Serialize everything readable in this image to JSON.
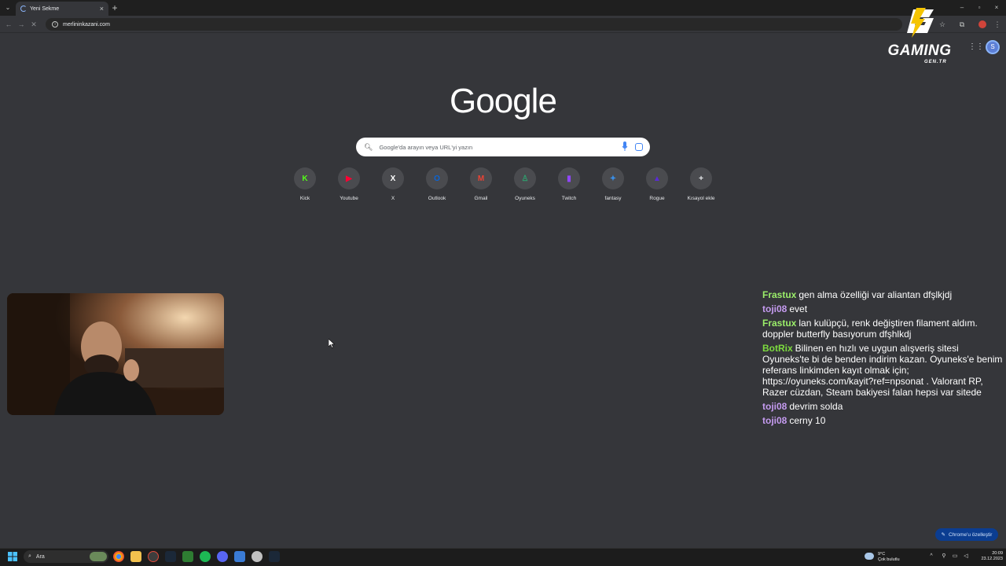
{
  "browser": {
    "tab_title": "Yeni Sekme",
    "tab_close": "×",
    "new_tab": "+",
    "url": "merlininkazani.com",
    "window_controls": [
      "–",
      "▫",
      "×"
    ]
  },
  "overlay": {
    "logo_name": "GAMING",
    "logo_sub": "GEN.TR"
  },
  "profile_initial": "S",
  "google": {
    "logo": "Google",
    "search_placeholder": "Google'da arayın veya URL'yi yazın"
  },
  "shortcuts": [
    {
      "label": "Kick",
      "icon": "kick-icon",
      "color": "#53fc18",
      "glyph": "K"
    },
    {
      "label": "Youtube",
      "icon": "youtube-icon",
      "color": "#ff0033",
      "glyph": "▶"
    },
    {
      "label": "X",
      "icon": "x-icon",
      "color": "#ffffff",
      "glyph": "X"
    },
    {
      "label": "Outlook",
      "icon": "outlook-icon",
      "color": "#0a64d6",
      "glyph": "O"
    },
    {
      "label": "Gmail",
      "icon": "gmail-icon",
      "color": "#ea4335",
      "glyph": "M"
    },
    {
      "label": "Oyuneks",
      "icon": "oyuneks-icon",
      "color": "#2f9e6e",
      "glyph": "♙"
    },
    {
      "label": "Twitch",
      "icon": "twitch-icon",
      "color": "#9146ff",
      "glyph": "▮"
    },
    {
      "label": "fantasy",
      "icon": "fantasy-icon",
      "color": "#3a8ee6",
      "glyph": "✦"
    },
    {
      "label": "Rogue",
      "icon": "rogue-icon",
      "color": "#5a2bd6",
      "glyph": "▲"
    },
    {
      "label": "Kısayol ekle",
      "icon": "add-shortcut-icon",
      "color": "#e8eaed",
      "glyph": "+"
    }
  ],
  "chat": [
    {
      "user": "Frastux",
      "color": "#9bee6a",
      "text": "gen alma özelliği var aliantan dfşlkjdj"
    },
    {
      "user": "toji08",
      "color": "#c59bf0",
      "text": "evet"
    },
    {
      "user": "Frastux",
      "color": "#9bee6a",
      "text": "lan kulüpçü, renk değiştiren filament aldım. doppler butterfly basıyorum dfşhlkdj"
    },
    {
      "user": "BotRix",
      "color": "#7ddc3f",
      "text": "Bilinen en hızlı ve uygun alışveriş sitesi Oyuneks'te bi de benden indirim kazan. Oyuneks'e benim referans linkimden kayıt olmak için; https://oyuneks.com/kayit?ref=npsonat . Valorant RP, Razer cüzdan, Steam bakiyesi falan hepsi var sitede"
    },
    {
      "user": "toji08",
      "color": "#c59bf0",
      "text": "devrim solda"
    },
    {
      "user": "toji08",
      "color": "#c59bf0",
      "text": "cerny 10"
    }
  ],
  "customize_label": "Chrome'u özelleştir",
  "taskbar": {
    "search_label": "Ara",
    "weather_temp": "9°C",
    "weather_desc": "Çok bulutlu",
    "time": "20:09",
    "date": "23.12.2023"
  }
}
